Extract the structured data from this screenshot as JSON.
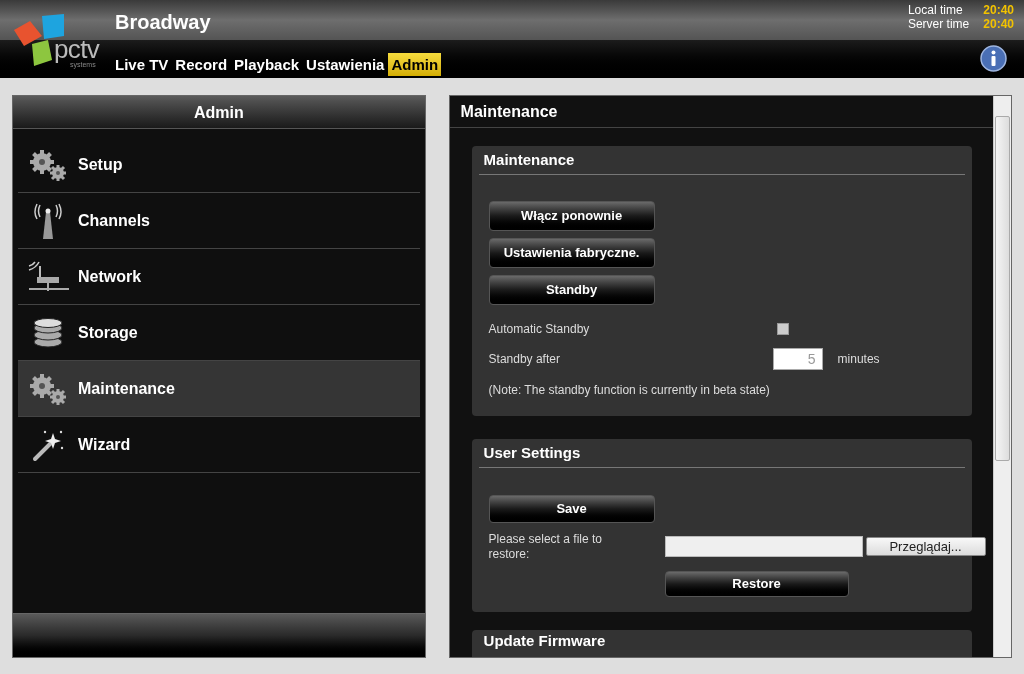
{
  "header": {
    "title": "Broadway",
    "logo_text": "pctv",
    "logo_subtext": "systems",
    "nav": [
      {
        "label": "Live TV",
        "selected": false
      },
      {
        "label": "Record",
        "selected": false
      },
      {
        "label": "Playback",
        "selected": false
      },
      {
        "label": "Ustawienia",
        "selected": false
      },
      {
        "label": "Admin",
        "selected": true
      }
    ],
    "times": [
      {
        "label": "Local time",
        "value": "20:40"
      },
      {
        "label": "Server time",
        "value": "20:40"
      }
    ]
  },
  "sidebar": {
    "title": "Admin",
    "items": [
      {
        "label": "Setup",
        "selected": false
      },
      {
        "label": "Channels",
        "selected": false
      },
      {
        "label": "Network",
        "selected": false
      },
      {
        "label": "Storage",
        "selected": false
      },
      {
        "label": "Maintenance",
        "selected": true
      },
      {
        "label": "Wizard",
        "selected": false
      }
    ]
  },
  "content": {
    "title": "Maintenance",
    "maintenance": {
      "title": "Maintenance",
      "buttons": [
        "Włącz ponownie",
        "Ustawienia fabryczne.",
        "Standby"
      ],
      "automatic_standby": {
        "label": "Automatic Standby",
        "checked": false
      },
      "standby_after": {
        "label": "Standby after",
        "value": "5",
        "unit": "minutes"
      },
      "note": "(Note: The standby function is currently in beta state)"
    },
    "user_settings": {
      "title": "User Settings",
      "save_button": "Save",
      "restore_label": "Please select a file to restore:",
      "browse_button": "Przeglądaj...",
      "restore_button": "Restore"
    },
    "update_firmware": {
      "title": "Update Firmware"
    }
  }
}
